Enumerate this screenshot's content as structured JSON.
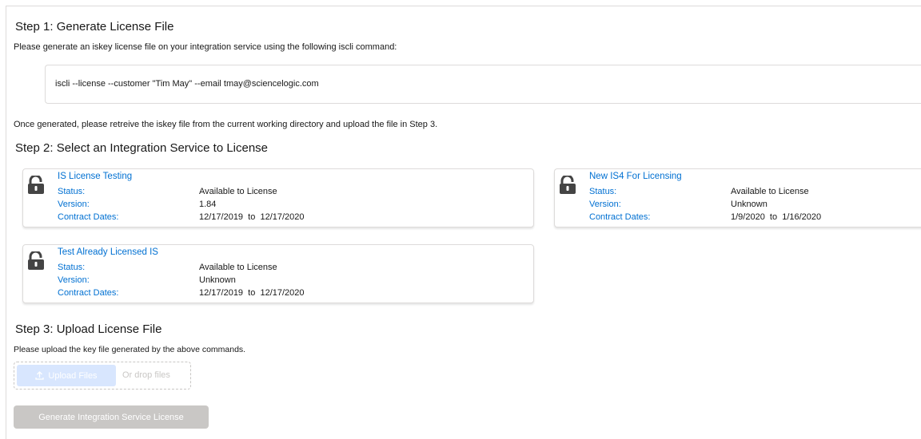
{
  "step1": {
    "title": "Step 1: Generate License File",
    "instructions": "Please generate an iskey license file on your integration service using the following iscli command:",
    "command": "iscli --license --customer \"Tim May\" --email tmay@sciencelogic.com",
    "after_note": "Once generated, please retreive the iskey file from the current working directory and upload the file in Step 3."
  },
  "step2": {
    "title": "Step 2: Select an Integration Service to License",
    "status_label": "Status:",
    "version_label": "Version:",
    "dates_label": "Contract Dates:",
    "cards": [
      {
        "name": "IS License Testing",
        "status": "Available to License",
        "version": "1.84",
        "dates": "12/17/2019  to  12/17/2020",
        "icon": "unlocked-padlock-icon"
      },
      {
        "name": "New IS4 For Licensing",
        "status": "Available to License",
        "version": "Unknown",
        "dates": "1/9/2020  to  1/16/2020",
        "icon": "unlocked-padlock-icon"
      },
      {
        "name": "Test Already Licensed IS",
        "status": "Available to License",
        "version": "Unknown",
        "dates": "12/17/2019  to  12/17/2020",
        "icon": "unlocked-padlock-icon"
      }
    ]
  },
  "step3": {
    "title": "Step 3: Upload License File",
    "instructions": "Please upload the key file generated by the above commands.",
    "upload_button": "Upload Files",
    "drop_text": "Or drop files",
    "upload_icon": "upload-icon"
  },
  "generate_button": "Generate Integration Service License",
  "colors": {
    "link": "#0070d2",
    "text": "#181818",
    "disabled_button": "#c9c7c5",
    "upload_button": "#d8e6fe",
    "border": "#dddbda"
  }
}
